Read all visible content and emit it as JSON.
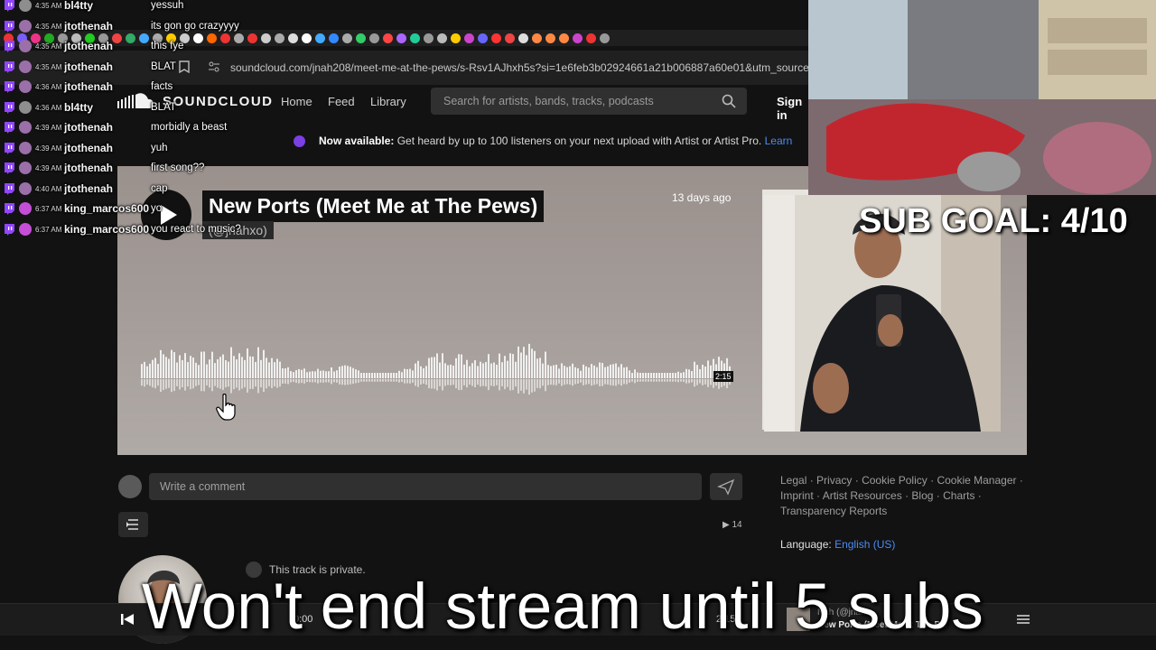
{
  "browser": {
    "url": "soundcloud.com/jnah208/meet-me-at-the-pews/s-Rsv1AJhxh5s?si=1e6feb3b02924661a21b006887a60e01&utm_source=clip"
  },
  "soundcloud": {
    "logo_text": "SOUNDCLOUD",
    "nav": {
      "home": "Home",
      "feed": "Feed",
      "library": "Library"
    },
    "search_placeholder": "Search for artists, bands, tracks, podcasts",
    "sign_in": "Sign in",
    "banner": {
      "bold": "Now available:",
      "text": " Get heard by up to 100 listeners on your next upload with Artist or Artist Pro. ",
      "link": "Learn"
    },
    "track": {
      "title": "New Ports (Meet Me at The Pews)",
      "artist": "(@jnahxo)",
      "date": "13 days ago",
      "waveform_duration": "2:15"
    },
    "comment_placeholder": "Write a comment",
    "plays": "14",
    "private_text": "This track is private.",
    "footer": {
      "links": [
        "Legal",
        "Privacy",
        "Cookie Policy",
        "Cookie Manager",
        "Imprint",
        "Artist Resources",
        "Blog",
        "Charts",
        "Transparency Reports"
      ],
      "language_label": "Language:",
      "language_value": "English (US)"
    },
    "player": {
      "current_time": "0:00",
      "duration": "2:15",
      "mini_artist": "Nah (@jnah...",
      "mini_title": "New Ports (Meet Me at The P..."
    }
  },
  "chat": [
    {
      "time": "4:35 AM",
      "user": "bl4tty",
      "msg": "yessuh",
      "color": "#8e8e8e"
    },
    {
      "time": "4:35 AM",
      "user": "jtothenah",
      "msg": "its gon go crazyyyy",
      "color": "#9b6fa8"
    },
    {
      "time": "4:35 AM",
      "user": "jtothenah",
      "msg": "this fye",
      "color": "#9b6fa8"
    },
    {
      "time": "4:35 AM",
      "user": "jtothenah",
      "msg": "BLAT",
      "color": "#9b6fa8"
    },
    {
      "time": "4:36 AM",
      "user": "jtothenah",
      "msg": "facts",
      "color": "#9b6fa8"
    },
    {
      "time": "4:36 AM",
      "user": "bl4tty",
      "msg": "BLAT",
      "color": "#8e8e8e"
    },
    {
      "time": "4:39 AM",
      "user": "jtothenah",
      "msg": "morbidly a beast",
      "color": "#9b6fa8"
    },
    {
      "time": "4:39 AM",
      "user": "jtothenah",
      "msg": "yuh",
      "color": "#9b6fa8"
    },
    {
      "time": "4:39 AM",
      "user": "jtothenah",
      "msg": "first song??",
      "color": "#9b6fa8"
    },
    {
      "time": "4:40 AM",
      "user": "jtothenah",
      "msg": "cap",
      "color": "#9b6fa8"
    },
    {
      "time": "6:37 AM",
      "user": "king_marcos600",
      "msg": "yo",
      "color": "#c44fd6"
    },
    {
      "time": "6:37 AM",
      "user": "king_marcos600",
      "msg": "you react to music?",
      "color": "#c44fd6"
    }
  ],
  "overlays": {
    "sub_goal": "SUB GOAL: 4/10",
    "bottom_text": "Won't end stream until 5 subs"
  },
  "colors": {
    "accent_link": "#4c8bf5",
    "banner_dot": "#7b3fe4",
    "twitch_purple": "#9146ff"
  },
  "icons": [
    "twitch-icon",
    "search-icon",
    "send-icon",
    "queue-icon",
    "play-icon",
    "prev-icon",
    "list-icon",
    "lock-icon",
    "bookmark-icon",
    "site-info-icon",
    "hand-cursor-icon"
  ]
}
